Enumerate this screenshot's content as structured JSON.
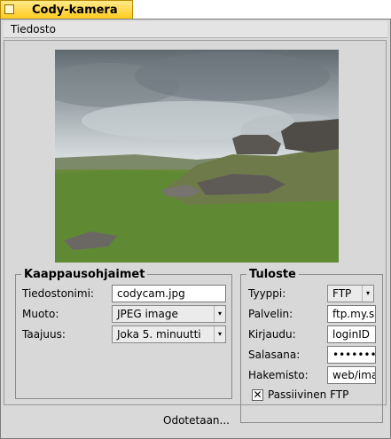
{
  "window": {
    "title": "Cody-kamera"
  },
  "menu": {
    "file": "Tiedosto"
  },
  "capture": {
    "legend": "Kaappausohjaimet",
    "filename_label": "Tiedostonimi:",
    "filename_value": "codycam.jpg",
    "format_label": "Muoto:",
    "format_value": "JPEG image",
    "freq_label": "Taajuus:",
    "freq_value": "Joka 5. minuutti"
  },
  "output": {
    "legend": "Tuloste",
    "type_label": "Tyyppi:",
    "type_value": "FTP",
    "server_label": "Palvelin:",
    "server_value": "ftp.my.s",
    "login_label": "Kirjaudu:",
    "login_value": "loginID",
    "password_label": "Salasana:",
    "password_value": "••••••••",
    "dir_label": "Hakemisto:",
    "dir_value": "web/ima",
    "passive_label": "Passiivinen FTP",
    "passive_checked": true,
    "passive_mark": "✕"
  },
  "status": "Odotetaan..."
}
